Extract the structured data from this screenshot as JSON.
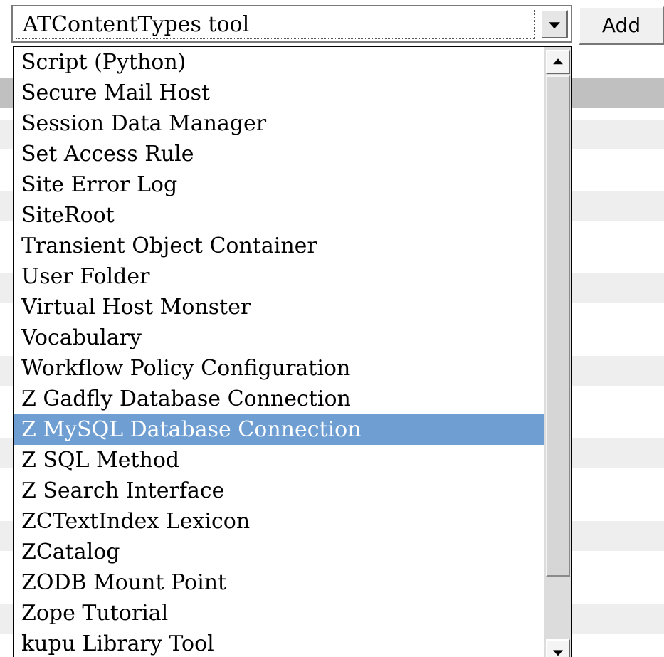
{
  "colors": {
    "selected_background": "#6f9ed2",
    "selected_text": "#ffffff",
    "page_stripe": "#eeeeee",
    "page_header_stripe": "#c0c0c0"
  },
  "add_type_select": {
    "value": "ATContentTypes tool",
    "icon": "chevron-down-icon"
  },
  "add_button": {
    "label": "Add"
  },
  "dropdown": {
    "options": [
      "Script (Python)",
      "Secure Mail Host",
      "Session Data Manager",
      "Set Access Rule",
      "Site Error Log",
      "SiteRoot",
      "Transient Object Container",
      "User Folder",
      "Virtual Host Monster",
      "Vocabulary",
      "Workflow Policy Configuration",
      "Z Gadfly Database Connection",
      "Z MySQL Database Connection",
      "Z SQL Method",
      "Z Search Interface",
      "ZCTextIndex Lexicon",
      "ZCatalog",
      "ZODB Mount Point",
      "Zope Tutorial",
      "kupu Library Tool"
    ],
    "highlighted": "Z MySQL Database Connection"
  },
  "scrollbar": {
    "up_icon": "arrow-up-icon",
    "down_icon": "arrow-down-icon"
  }
}
